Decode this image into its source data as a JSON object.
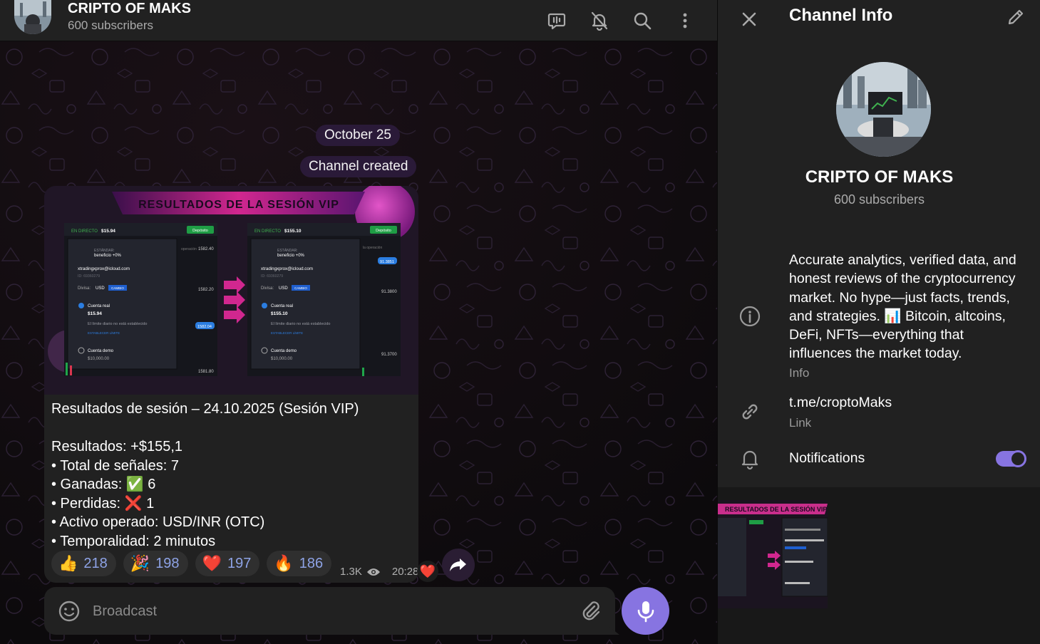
{
  "header": {
    "title": "CRIPTO OF MAKS",
    "subtitle": "600 subscribers"
  },
  "chat": {
    "date_pill": "October 25",
    "service_pill": "Channel created",
    "post": {
      "image": {
        "banner": "RESULTADOS DE LA SESIÓN VIP",
        "left_card": {
          "live_label": "EN DIRECTO",
          "balance": "$15.94",
          "deposit": "Depósito",
          "std": "ESTÁNDAR:",
          "benefit": "beneficio +0%",
          "email": "xtradingxprox@icloud.com",
          "id": "ID: 69360279",
          "currency_label": "Divisa:",
          "currency": "USD",
          "change": "CAMBIO",
          "real": "Cuenta real",
          "real_amt": "$15.94",
          "limit": "El límite diario no está establecido",
          "set_limit": "ESTABLECER LÍMITE",
          "demo": "Cuenta demo",
          "demo_amt": "$10,000.00",
          "p1": "1582.40",
          "p2": "1582.20",
          "p3": "1582.04",
          "p4": "1581.80",
          "opera": "operación"
        },
        "right_card": {
          "live_label": "EN DIRECTO",
          "balance": "$155.10",
          "deposit": "Depósito",
          "std": "ESTÁNDAR:",
          "benefit": "beneficio +0%",
          "email": "xtradingxprox@icloud.com",
          "id": "ID: 69360279",
          "currency_label": "Divisa:",
          "currency": "USD",
          "change": "CAMBIO",
          "real": "Cuenta real",
          "real_amt": "$155.10",
          "limit": "El límite diario no está establecido",
          "set_limit": "ESTABLECER LÍMITE",
          "demo": "Cuenta demo",
          "demo_amt": "$10,000.00",
          "p1": "91.3851",
          "p2": "91.3800",
          "p3": "91.3700",
          "opera": "la operación"
        }
      },
      "text": "Resultados de sesión – 24.10.2025 (Sesión VIP)\n\n Resultados: +$155,1\n• Total de señales: 7\n• Ganadas: ✅ 6\n• Perdidas: ❌ 1\n• Activo operado: USD/INR (OTC)\n• Temporalidad: 2 minutos",
      "reactions": [
        {
          "emoji": "👍",
          "count": "218"
        },
        {
          "emoji": "🎉",
          "count": "198"
        },
        {
          "emoji": "❤️",
          "count": "197"
        },
        {
          "emoji": "🔥",
          "count": "186"
        }
      ],
      "views": "1.3K",
      "time": "20:28",
      "my_reaction": "❤️"
    },
    "composer": {
      "placeholder": "Broadcast"
    }
  },
  "info_panel": {
    "title": "Channel Info",
    "name": "CRIPTO OF MAKS",
    "subscribers": "600 subscribers",
    "description": "Accurate analytics, verified data, and honest reviews of the cryptocurrency market. No hype—just facts, trends, and strategies. 📊 Bitcoin, altcoins, DeFi, NFTs—everything that influences the market today.",
    "description_label": "Info",
    "link": "t.me/croptoMaks",
    "link_label": "Link",
    "notifications_label": "Notifications",
    "notifications_on": true,
    "thumb_banner": "RESULTADOS DE LA SESIÓN VIP"
  },
  "colors": {
    "accent": "#8774e1",
    "panel": "#212121",
    "chat_bg": "#0e0b0d",
    "reaction_count": "#8ea3e6",
    "banner_pink": "#e0349a"
  },
  "icons": {
    "header": [
      "live-stream-icon",
      "mute-bell-icon",
      "search-icon",
      "more-vertical-icon"
    ],
    "composer": [
      "smile-icon",
      "paperclip-icon",
      "microphone-icon"
    ],
    "info": [
      "close-icon",
      "pencil-icon",
      "info-circle-icon",
      "link-icon",
      "bell-icon"
    ]
  }
}
